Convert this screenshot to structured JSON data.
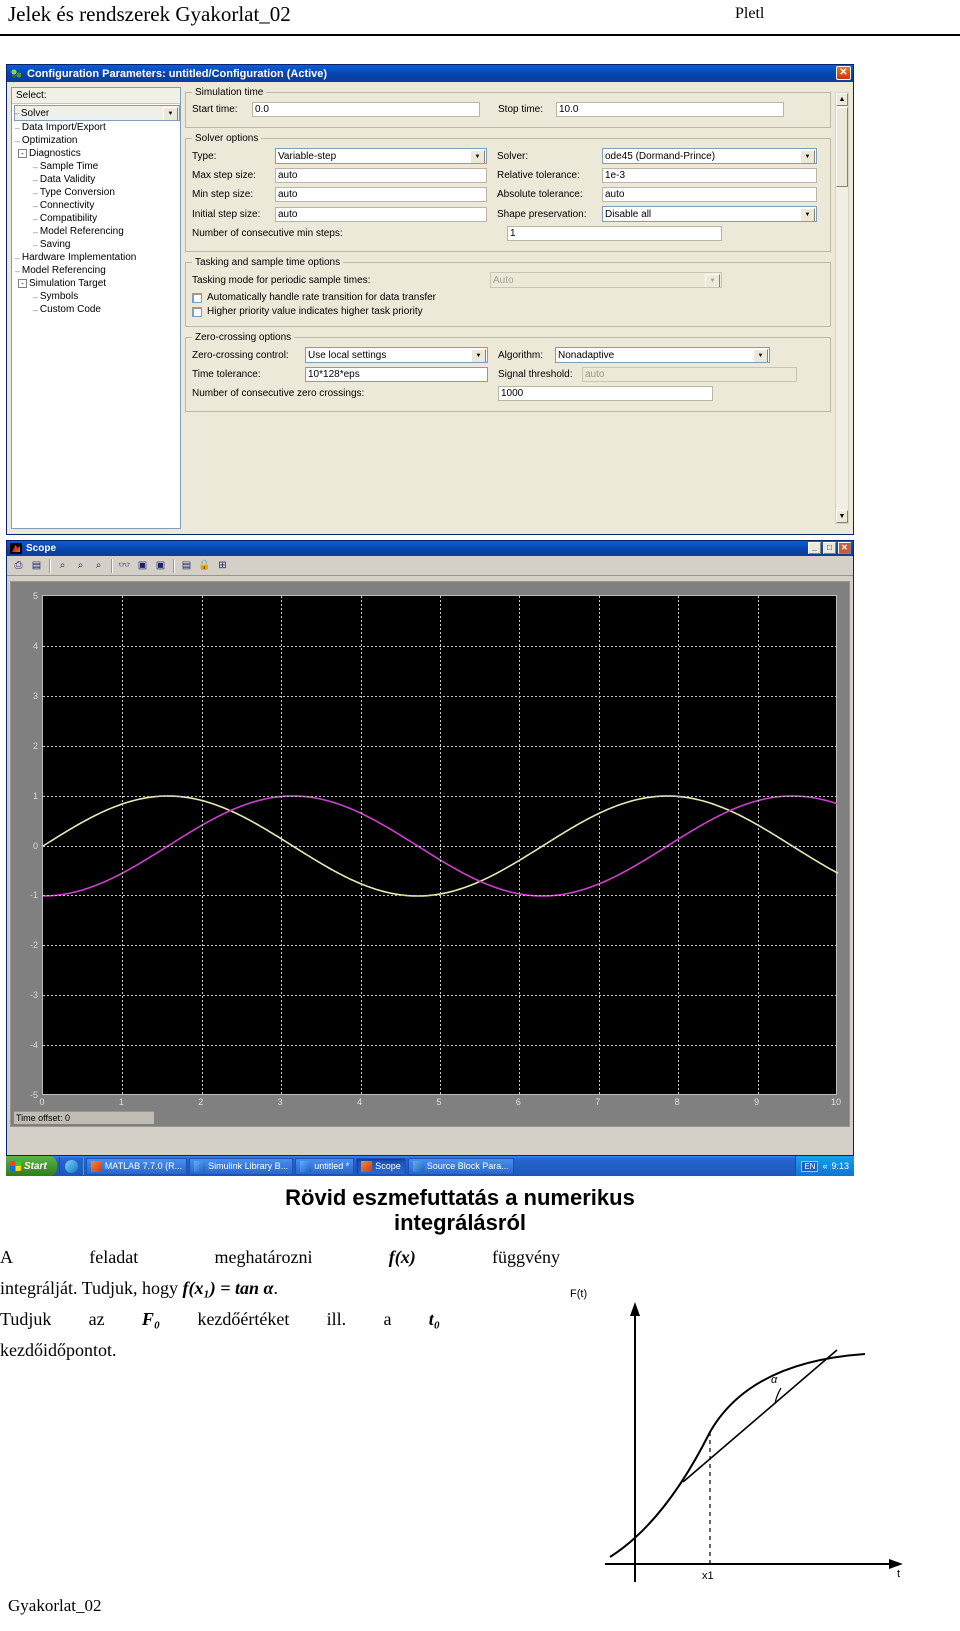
{
  "page_header": {
    "title": "Jelek és rendszerek Gyakorlat_02",
    "author": "Pletl"
  },
  "config_dialog": {
    "title": "Configuration Parameters: untitled/Configuration (Active)",
    "icon": "simulink-gear-icon",
    "close_label": "✕",
    "select_label": "Select:",
    "tree": [
      {
        "label": "Solver",
        "indent": 0,
        "expander": "",
        "selected": true
      },
      {
        "label": "Data Import/Export",
        "indent": 0,
        "expander": "",
        "selected": false
      },
      {
        "label": "Optimization",
        "indent": 0,
        "expander": "",
        "selected": false
      },
      {
        "label": "Diagnostics",
        "indent": 0,
        "expander": "-",
        "selected": false
      },
      {
        "label": "Sample Time",
        "indent": 1,
        "expander": "",
        "selected": false
      },
      {
        "label": "Data Validity",
        "indent": 1,
        "expander": "",
        "selected": false
      },
      {
        "label": "Type Conversion",
        "indent": 1,
        "expander": "",
        "selected": false
      },
      {
        "label": "Connectivity",
        "indent": 1,
        "expander": "",
        "selected": false
      },
      {
        "label": "Compatibility",
        "indent": 1,
        "expander": "",
        "selected": false
      },
      {
        "label": "Model Referencing",
        "indent": 1,
        "expander": "",
        "selected": false
      },
      {
        "label": "Saving",
        "indent": 1,
        "expander": "",
        "selected": false
      },
      {
        "label": "Hardware Implementation",
        "indent": 0,
        "expander": "",
        "selected": false
      },
      {
        "label": "Model Referencing",
        "indent": 0,
        "expander": "",
        "selected": false
      },
      {
        "label": "Simulation Target",
        "indent": 0,
        "expander": "-",
        "selected": false
      },
      {
        "label": "Symbols",
        "indent": 1,
        "expander": "",
        "selected": false
      },
      {
        "label": "Custom Code",
        "indent": 1,
        "expander": "",
        "selected": false
      }
    ],
    "simulation_time": {
      "legend": "Simulation time",
      "start_time_label": "Start time:",
      "start_time_value": "0.0",
      "stop_time_label": "Stop time:",
      "stop_time_value": "10.0"
    },
    "solver_options": {
      "legend": "Solver options",
      "type_label": "Type:",
      "type_value": "Variable-step",
      "solver_label": "Solver:",
      "solver_value": "ode45 (Dormand-Prince)",
      "max_step_label": "Max step size:",
      "max_step_value": "auto",
      "relative_tol_label": "Relative tolerance:",
      "relative_tol_value": "1e-3",
      "min_step_label": "Min step size:",
      "min_step_value": "auto",
      "absolute_tol_label": "Absolute tolerance:",
      "absolute_tol_value": "auto",
      "initial_step_label": "Initial step size:",
      "initial_step_value": "auto",
      "shape_pres_label": "Shape preservation:",
      "shape_pres_value": "Disable all",
      "consec_min_label": "Number of consecutive min steps:",
      "consec_min_value": "1"
    },
    "tasking_options": {
      "legend": "Tasking and sample time options",
      "mode_label": "Tasking mode for periodic sample times:",
      "mode_value": "Auto",
      "auto_rate_label": "Automatically handle rate transition for data transfer",
      "auto_rate_checked": false,
      "priority_label": "Higher priority value indicates higher task priority",
      "priority_checked": false
    },
    "zero_crossing": {
      "legend": "Zero-crossing options",
      "control_label": "Zero-crossing control:",
      "control_value": "Use local settings",
      "algorithm_label": "Algorithm:",
      "algorithm_value": "Nonadaptive",
      "time_tol_label": "Time tolerance:",
      "time_tol_value": "10*128*eps",
      "signal_thr_label": "Signal threshold:",
      "signal_thr_value": "auto",
      "consec_zc_label": "Number of consecutive zero crossings:",
      "consec_zc_value": "1000"
    }
  },
  "scope_window": {
    "title": "Scope",
    "icon": "matlab-icon",
    "minimize_label": "_",
    "maximize_label": "□",
    "close_label": "✕",
    "toolbar": [
      {
        "name": "print-icon",
        "glyph": "⎙"
      },
      {
        "name": "parameters-icon",
        "glyph": "▤"
      },
      {
        "name": "zoom-icon",
        "glyph": "⌕"
      },
      {
        "name": "zoom-x-icon",
        "glyph": "⌕"
      },
      {
        "name": "zoom-y-icon",
        "glyph": "⌕"
      },
      {
        "name": "autoscale-binoculars-icon",
        "glyph": "👓"
      },
      {
        "name": "save-axes-settings-icon",
        "glyph": "▣"
      },
      {
        "name": "restore-axes-settings-icon",
        "glyph": "▣"
      },
      {
        "name": "floating-scope-icon",
        "glyph": "▤"
      },
      {
        "name": "lock-axes-icon",
        "glyph": "🔒"
      },
      {
        "name": "signal-selection-icon",
        "glyph": "⊞"
      }
    ],
    "time_offset_label": "Time offset:",
    "time_offset_value": "0"
  },
  "chart_data": {
    "type": "line",
    "title": "Scope",
    "xlabel": "",
    "ylabel": "",
    "xlim": [
      0,
      10
    ],
    "ylim": [
      -5,
      5
    ],
    "xticks": [
      "0",
      "1",
      "2",
      "3",
      "4",
      "5",
      "6",
      "7",
      "8",
      "9",
      "10"
    ],
    "yticks": [
      "5",
      "4",
      "3",
      "2",
      "1",
      "0",
      "-1",
      "-2",
      "-3",
      "-4",
      "-5"
    ],
    "grid": true,
    "background": "#000000",
    "legend_position": "none",
    "series": [
      {
        "name": "sine",
        "color": "#e8e8b0",
        "description": "sin(t), amplitude 1, period ~6.28 s, starts at 0",
        "amplitude": 1,
        "offset": 0,
        "phase": 0,
        "period": 6.283
      },
      {
        "name": "cosine-minus-one",
        "color": "#cc40cc",
        "description": "-cos(t), amplitude 1, offset 0, starts at -1",
        "amplitude": 1,
        "offset": 0,
        "phase": 4.712,
        "period": 6.283
      }
    ]
  },
  "taskbar": {
    "start_label": "Start",
    "items": [
      {
        "label": "MATLAB 7.7.0 (R...",
        "icon": "matlab-icon",
        "active": false
      },
      {
        "label": "Simulink Library B...",
        "icon": "simulink-icon",
        "active": false
      },
      {
        "label": "untitled *",
        "icon": "simulink-icon",
        "active": false
      },
      {
        "label": "Scope",
        "icon": "matlab-icon",
        "active": true
      },
      {
        "label": "Source Block Para...",
        "icon": "simulink-icon",
        "active": false
      }
    ],
    "tray": {
      "language": "EN",
      "chevron": "«",
      "clock": "9:13"
    }
  },
  "lesson": {
    "heading_line1": "Rövid eszmefuttatás a numerikus",
    "heading_line2": "integrálásról",
    "paragraph1_a": "A",
    "paragraph1_b": "feladat",
    "paragraph1_c": "meghatározni",
    "paragraph1_formula1": "f(x)",
    "paragraph1_d": "függvény",
    "paragraph2_a": "integrálját. Tudjuk, hogy",
    "paragraph2_formula": "f(x₁) = tan α",
    "paragraph2_b": ".",
    "paragraph3_a": "Tudjuk",
    "paragraph3_b": "az",
    "paragraph3_formula1": "F₀",
    "paragraph3_c": "kezdőértéket",
    "paragraph3_d": "ill.",
    "paragraph3_e": "a",
    "paragraph3_formula2": "t₀",
    "paragraph4": "kezdőidőpontot.",
    "figure": {
      "y_axis_label": "F(t)",
      "x_axis_label": "t",
      "angle_label": "α",
      "point_label": "x1"
    },
    "footer": "Gyakorlat_02"
  }
}
